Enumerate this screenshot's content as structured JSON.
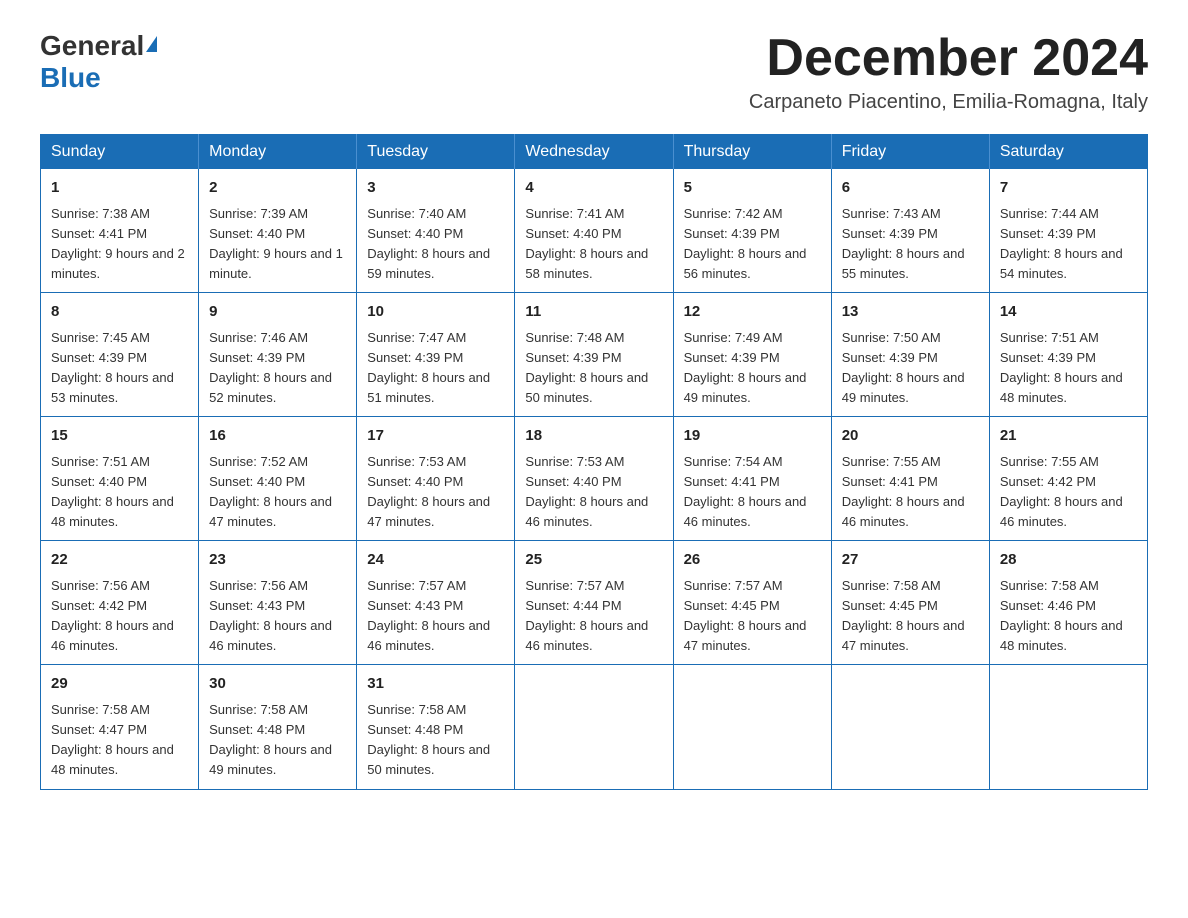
{
  "header": {
    "logo_general": "General",
    "logo_blue": "Blue",
    "month_title": "December 2024",
    "location": "Carpaneto Piacentino, Emilia-Romagna, Italy"
  },
  "weekdays": [
    "Sunday",
    "Monday",
    "Tuesday",
    "Wednesday",
    "Thursday",
    "Friday",
    "Saturday"
  ],
  "weeks": [
    [
      {
        "day": "1",
        "sunrise": "7:38 AM",
        "sunset": "4:41 PM",
        "daylight": "9 hours and 2 minutes."
      },
      {
        "day": "2",
        "sunrise": "7:39 AM",
        "sunset": "4:40 PM",
        "daylight": "9 hours and 1 minute."
      },
      {
        "day": "3",
        "sunrise": "7:40 AM",
        "sunset": "4:40 PM",
        "daylight": "8 hours and 59 minutes."
      },
      {
        "day": "4",
        "sunrise": "7:41 AM",
        "sunset": "4:40 PM",
        "daylight": "8 hours and 58 minutes."
      },
      {
        "day": "5",
        "sunrise": "7:42 AM",
        "sunset": "4:39 PM",
        "daylight": "8 hours and 56 minutes."
      },
      {
        "day": "6",
        "sunrise": "7:43 AM",
        "sunset": "4:39 PM",
        "daylight": "8 hours and 55 minutes."
      },
      {
        "day": "7",
        "sunrise": "7:44 AM",
        "sunset": "4:39 PM",
        "daylight": "8 hours and 54 minutes."
      }
    ],
    [
      {
        "day": "8",
        "sunrise": "7:45 AM",
        "sunset": "4:39 PM",
        "daylight": "8 hours and 53 minutes."
      },
      {
        "day": "9",
        "sunrise": "7:46 AM",
        "sunset": "4:39 PM",
        "daylight": "8 hours and 52 minutes."
      },
      {
        "day": "10",
        "sunrise": "7:47 AM",
        "sunset": "4:39 PM",
        "daylight": "8 hours and 51 minutes."
      },
      {
        "day": "11",
        "sunrise": "7:48 AM",
        "sunset": "4:39 PM",
        "daylight": "8 hours and 50 minutes."
      },
      {
        "day": "12",
        "sunrise": "7:49 AM",
        "sunset": "4:39 PM",
        "daylight": "8 hours and 49 minutes."
      },
      {
        "day": "13",
        "sunrise": "7:50 AM",
        "sunset": "4:39 PM",
        "daylight": "8 hours and 49 minutes."
      },
      {
        "day": "14",
        "sunrise": "7:51 AM",
        "sunset": "4:39 PM",
        "daylight": "8 hours and 48 minutes."
      }
    ],
    [
      {
        "day": "15",
        "sunrise": "7:51 AM",
        "sunset": "4:40 PM",
        "daylight": "8 hours and 48 minutes."
      },
      {
        "day": "16",
        "sunrise": "7:52 AM",
        "sunset": "4:40 PM",
        "daylight": "8 hours and 47 minutes."
      },
      {
        "day": "17",
        "sunrise": "7:53 AM",
        "sunset": "4:40 PM",
        "daylight": "8 hours and 47 minutes."
      },
      {
        "day": "18",
        "sunrise": "7:53 AM",
        "sunset": "4:40 PM",
        "daylight": "8 hours and 46 minutes."
      },
      {
        "day": "19",
        "sunrise": "7:54 AM",
        "sunset": "4:41 PM",
        "daylight": "8 hours and 46 minutes."
      },
      {
        "day": "20",
        "sunrise": "7:55 AM",
        "sunset": "4:41 PM",
        "daylight": "8 hours and 46 minutes."
      },
      {
        "day": "21",
        "sunrise": "7:55 AM",
        "sunset": "4:42 PM",
        "daylight": "8 hours and 46 minutes."
      }
    ],
    [
      {
        "day": "22",
        "sunrise": "7:56 AM",
        "sunset": "4:42 PM",
        "daylight": "8 hours and 46 minutes."
      },
      {
        "day": "23",
        "sunrise": "7:56 AM",
        "sunset": "4:43 PM",
        "daylight": "8 hours and 46 minutes."
      },
      {
        "day": "24",
        "sunrise": "7:57 AM",
        "sunset": "4:43 PM",
        "daylight": "8 hours and 46 minutes."
      },
      {
        "day": "25",
        "sunrise": "7:57 AM",
        "sunset": "4:44 PM",
        "daylight": "8 hours and 46 minutes."
      },
      {
        "day": "26",
        "sunrise": "7:57 AM",
        "sunset": "4:45 PM",
        "daylight": "8 hours and 47 minutes."
      },
      {
        "day": "27",
        "sunrise": "7:58 AM",
        "sunset": "4:45 PM",
        "daylight": "8 hours and 47 minutes."
      },
      {
        "day": "28",
        "sunrise": "7:58 AM",
        "sunset": "4:46 PM",
        "daylight": "8 hours and 48 minutes."
      }
    ],
    [
      {
        "day": "29",
        "sunrise": "7:58 AM",
        "sunset": "4:47 PM",
        "daylight": "8 hours and 48 minutes."
      },
      {
        "day": "30",
        "sunrise": "7:58 AM",
        "sunset": "4:48 PM",
        "daylight": "8 hours and 49 minutes."
      },
      {
        "day": "31",
        "sunrise": "7:58 AM",
        "sunset": "4:48 PM",
        "daylight": "8 hours and 50 minutes."
      },
      null,
      null,
      null,
      null
    ]
  ],
  "labels": {
    "sunrise": "Sunrise: ",
    "sunset": "Sunset: ",
    "daylight": "Daylight: "
  }
}
